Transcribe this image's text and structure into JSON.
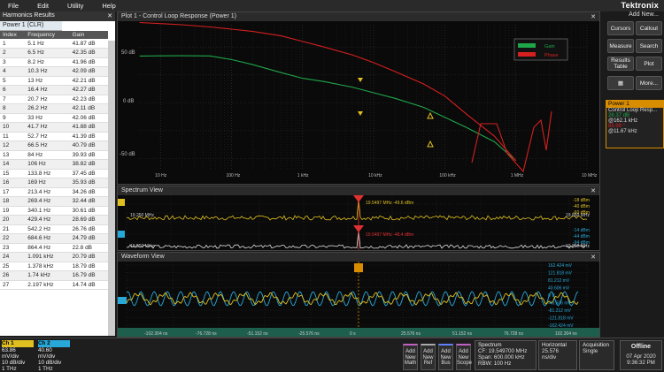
{
  "menu": [
    "File",
    "Edit",
    "Utility",
    "Help"
  ],
  "brand": {
    "logo": "Tektronix",
    "add_new": "Add New..."
  },
  "harmonics": {
    "title": "Harmonics Results",
    "tab": "Power 1 (CLR)",
    "headers": [
      "Index",
      "Frequency",
      "Gain"
    ],
    "rows": [
      [
        "1",
        "5.1 Hz",
        "41.87 dB"
      ],
      [
        "2",
        "6.5 Hz",
        "42.35 dB"
      ],
      [
        "3",
        "8.2 Hz",
        "41.96 dB"
      ],
      [
        "4",
        "10.3 Hz",
        "42.09 dB"
      ],
      [
        "5",
        "13 Hz",
        "42.21 dB"
      ],
      [
        "6",
        "16.4 Hz",
        "42.27 dB"
      ],
      [
        "7",
        "20.7 Hz",
        "42.23 dB"
      ],
      [
        "8",
        "26.2 Hz",
        "42.11 dB"
      ],
      [
        "9",
        "33 Hz",
        "42.06 dB"
      ],
      [
        "10",
        "41.7 Hz",
        "41.88 dB"
      ],
      [
        "11",
        "52.7 Hz",
        "41.39 dB"
      ],
      [
        "12",
        "66.5 Hz",
        "40.79 dB"
      ],
      [
        "13",
        "84 Hz",
        "39.93 dB"
      ],
      [
        "14",
        "106 Hz",
        "38.82 dB"
      ],
      [
        "15",
        "133.8 Hz",
        "37.45 dB"
      ],
      [
        "16",
        "169 Hz",
        "35.93 dB"
      ],
      [
        "17",
        "213.4 Hz",
        "34.26 dB"
      ],
      [
        "18",
        "269.4 Hz",
        "32.44 dB"
      ],
      [
        "19",
        "340.1 Hz",
        "30.61 dB"
      ],
      [
        "20",
        "429.4 Hz",
        "28.69 dB"
      ],
      [
        "21",
        "542.2 Hz",
        "26.76 dB"
      ],
      [
        "22",
        "684.6 Hz",
        "24.79 dB"
      ],
      [
        "23",
        "864.4 Hz",
        "22.8 dB"
      ],
      [
        "24",
        "1.091 kHz",
        "20.79 dB"
      ],
      [
        "25",
        "1.378 kHz",
        "18.79 dB"
      ],
      [
        "26",
        "1.74 kHz",
        "16.79 dB"
      ],
      [
        "27",
        "2.197 kHz",
        "14.74 dB"
      ]
    ]
  },
  "plot": {
    "title": "Plot 1 - Control Loop Response (Power 1)",
    "y_ticks": [
      "50 dB",
      "0 dB",
      "-50 dB"
    ],
    "x_ticks": [
      "10 Hz",
      "100 Hz",
      "1 kHz",
      "10 kHz",
      "100 kHz",
      "1 MHz",
      "10 MHz"
    ],
    "legend": [
      {
        "label": "Gain",
        "color": "#1fa64a"
      },
      {
        "label": "Phase",
        "color": "#d62020"
      }
    ]
  },
  "chart_data": {
    "type": "line",
    "x": [
      5.1,
      10,
      20,
      50,
      100,
      200,
      500,
      1000,
      2000,
      5000,
      10000,
      20000,
      50000,
      100000,
      200000,
      500000,
      1000000
    ],
    "series": [
      {
        "name": "Gain",
        "values": [
          41.9,
          42.1,
          42.2,
          42.0,
          38.8,
          34.2,
          27,
          22,
          19,
          14,
          9,
          4,
          -4,
          -13,
          -22,
          -35,
          -52
        ]
      },
      {
        "name": "Phase",
        "values": [
          72,
          71,
          70,
          68,
          66,
          64,
          60,
          55,
          50,
          43,
          36,
          28,
          17,
          6,
          -10,
          -30,
          -52
        ]
      }
    ],
    "xlim": [
      5,
      10000000
    ],
    "log_x": true,
    "ylim": [
      -60,
      70
    ]
  },
  "spectrum": {
    "title": "Spectrum View",
    "ch1_marker": "19.5497 MHz\n-49.6 dBm",
    "ch2_marker": "19.5497 MHz\n-48.4 dBm",
    "left_freq": "19.250 MHz",
    "right_freq": "19.850 MHz",
    "ch1_scale": [
      "-18 dBm",
      "-40 dBm",
      "-60 dBm"
    ],
    "ch2_scale": [
      "-14 dBm",
      "-44 dBm",
      "-94 dBm"
    ]
  },
  "waveform": {
    "title": "Waveform View",
    "time_ticks": [
      "-102.304 ns",
      "-76.728 ns",
      "-51.152 ns",
      "-25.576 ns",
      "0 s",
      "25.576 ns",
      "51.152 ns",
      "76.728 ns",
      "102.304 ns"
    ],
    "right_scale": [
      "162.424 mV",
      "121.818 mV",
      "81.212 mV",
      "40.606 mV",
      "0 V",
      "-40.606 mV",
      "-81.212 mV",
      "-121.818 mV",
      "-162.424 mV"
    ]
  },
  "sidebar": {
    "buttons": [
      "Cursors",
      "Callout",
      "Measure",
      "Search",
      "Results Table",
      "Plot",
      "More..."
    ]
  },
  "power_badge": {
    "title": "Power 1",
    "sub": "Control Loop Resp...",
    "v1": "26.37 dB",
    "v1b": "@162.1 kHz",
    "v2": "85.99 °",
    "v2b": "@11.67 kHz"
  },
  "bottom": {
    "ch1": {
      "label": "Ch 1",
      "l1": "63.86 mV/div",
      "l2": "10 dB/div",
      "l3": "1 THz",
      "color": "#e0c020"
    },
    "ch2": {
      "label": "Ch 2",
      "l1": "40.60 mV/div",
      "l2": "10 dB/div",
      "l3": "1 THz",
      "color": "#28a8d8"
    },
    "add": [
      {
        "t": "Add New Math"
      },
      {
        "t": "Add New Ref"
      },
      {
        "t": "Add New Bus"
      },
      {
        "t": "Add New Scope"
      }
    ],
    "spectrum": {
      "h": "Spectrum",
      "l1": "CF: 19.549700 MHz",
      "l2": "Span: 600.000 kHz",
      "l3": "RBW: 100 Hz"
    },
    "horizontal": {
      "h": "Horizontal",
      "l1": "25.576 ns/div"
    },
    "acq": {
      "h": "Acquisition",
      "l1": "Single"
    },
    "status": {
      "h": "Offline",
      "date": "07 Apr 2020",
      "time": "9:36:32 PM"
    }
  }
}
